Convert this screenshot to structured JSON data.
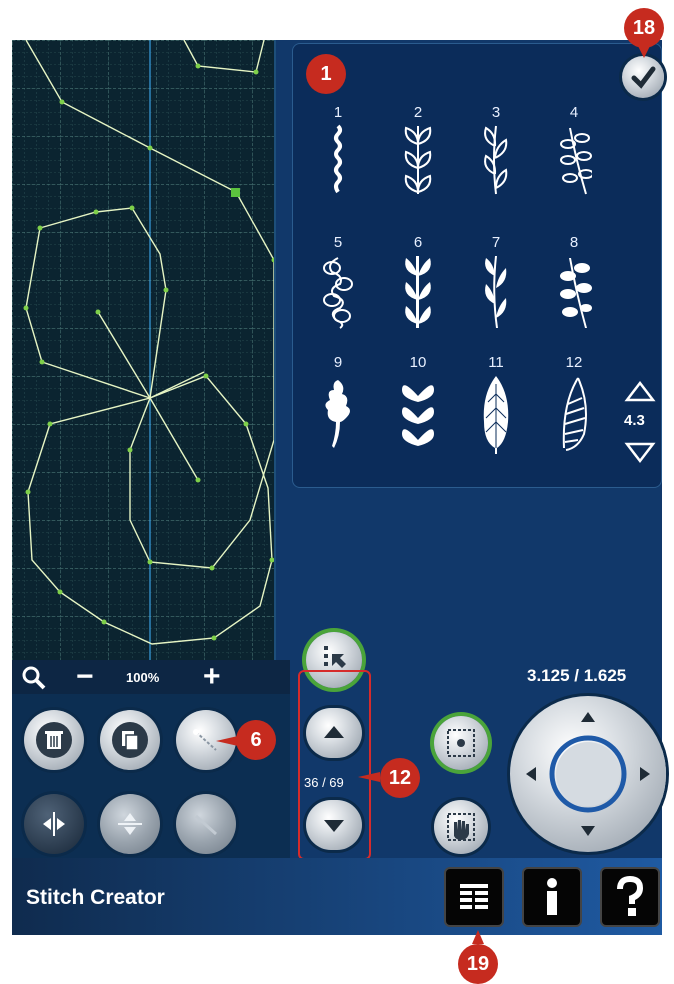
{
  "app": {
    "title": "Stitch Creator"
  },
  "zoom": {
    "level": "100%",
    "zoom_in_symbol": "+",
    "zoom_out_symbol": "−"
  },
  "stitch_menu": {
    "stitches": [
      {
        "number": "1"
      },
      {
        "number": "2"
      },
      {
        "number": "3"
      },
      {
        "number": "4"
      },
      {
        "number": "5"
      },
      {
        "number": "6"
      },
      {
        "number": "7"
      },
      {
        "number": "8"
      },
      {
        "number": "9"
      },
      {
        "number": "10"
      },
      {
        "number": "11"
      },
      {
        "number": "12"
      }
    ],
    "scroll_value": "4.3"
  },
  "stitch_position": {
    "counter": "36 / 69"
  },
  "coordinates": {
    "readout": "3.125 / 1.625"
  },
  "callouts": {
    "c1": "1",
    "c6": "6",
    "c12": "12",
    "c18": "18",
    "c19": "19"
  },
  "colors": {
    "accent_green": "#4aa43a",
    "callout_red": "#c62b1f",
    "background_blue": "#11386a",
    "stitch_line": "#e6f5c4"
  }
}
